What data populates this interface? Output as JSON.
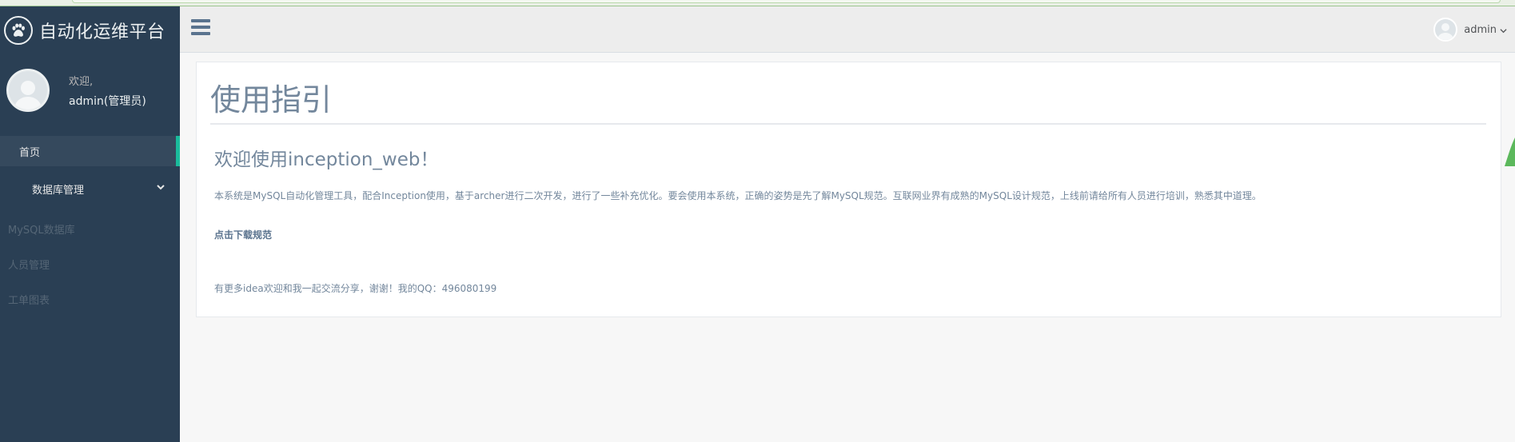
{
  "brand": {
    "title": "自动化运维平台",
    "logo_icon": "paw-icon"
  },
  "profile": {
    "welcome": "欢迎,",
    "name": "admin(管理员)",
    "avatar_icon": "user-avatar-icon"
  },
  "sidebar": {
    "items": [
      {
        "label": "首页",
        "active": true
      },
      {
        "label": "数据库管理",
        "expanded": true
      }
    ],
    "subitems": [
      {
        "label": "MySQL数据库"
      },
      {
        "label": "人员管理"
      },
      {
        "label": "工单图表"
      }
    ]
  },
  "topnav": {
    "user_name": "admin",
    "menu_icon": "hamburger-icon"
  },
  "main": {
    "page_title": "使用指引",
    "welcome": "欢迎使用inception_web！",
    "intro": "本系统是MySQL自动化管理工具，配合Inception使用，基于archer进行二次开发，进行了一些补充优化。要会使用本系统，正确的姿势是先了解MySQL规范。互联网业界有成熟的MySQL设计规范，上线前请给所有人员进行培训，熟悉其中道理。",
    "download_link": "点击下载规范",
    "contact": "有更多idea欢迎和我一起交流分享，谢谢！我的QQ：496080199"
  },
  "colors": {
    "sidebar_bg": "#2A3F54",
    "accent": "#1ABB9C",
    "topnav_bg": "#EDEDED",
    "text": "#73879C"
  }
}
